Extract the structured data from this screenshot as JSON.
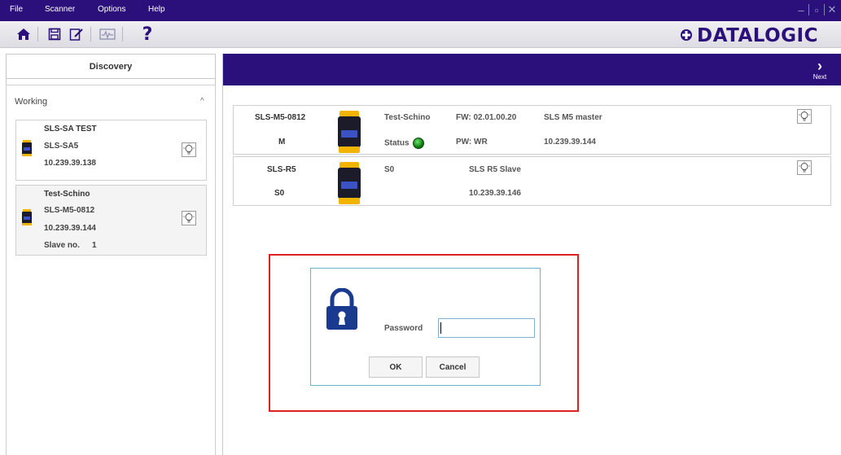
{
  "menu": {
    "file": "File",
    "scanner": "Scanner",
    "options": "Options",
    "help": "Help"
  },
  "window_controls": {
    "minimize": "–",
    "restore": "▫",
    "close": "✕"
  },
  "toolbar": {
    "help_label": "?"
  },
  "brand": {
    "logo_text": "DATALOGIC",
    "color": "#2b0f7a"
  },
  "left": {
    "discovery_label": "Discovery",
    "working_label": "Working",
    "working_caret": "^",
    "devices": [
      {
        "title": "SLS-SA TEST",
        "model": "SLS-SA5",
        "ip": "10.239.39.138"
      },
      {
        "title": "Test-Schino",
        "model": "SLS-M5-0812",
        "ip": "10.239.39.144",
        "slave_label": "Slave no.",
        "slave_value": "1"
      }
    ]
  },
  "main": {
    "next_arrow": "›",
    "next_label": "Next",
    "rows": [
      {
        "name": "SLS-M5-0812",
        "role": "M",
        "device_name": "Test-Schino",
        "status_label": "Status",
        "fw": "FW: 02.01.00.20",
        "pw": "PW: WR",
        "desc": "SLS M5 master",
        "ip": "10.239.39.144"
      },
      {
        "name": "SLS-R5",
        "role": "S0",
        "code": "S0",
        "desc": "SLS R5 Slave",
        "ip": "10.239.39.146"
      }
    ]
  },
  "dialog": {
    "password_label": "Password",
    "password_value": "",
    "ok_label": "OK",
    "cancel_label": "Cancel"
  },
  "colors": {
    "accent": "#2b0f7a",
    "highlight": "#e02020",
    "dialog_border": "#6ab0d8",
    "status_ok": "#1aa51a"
  }
}
